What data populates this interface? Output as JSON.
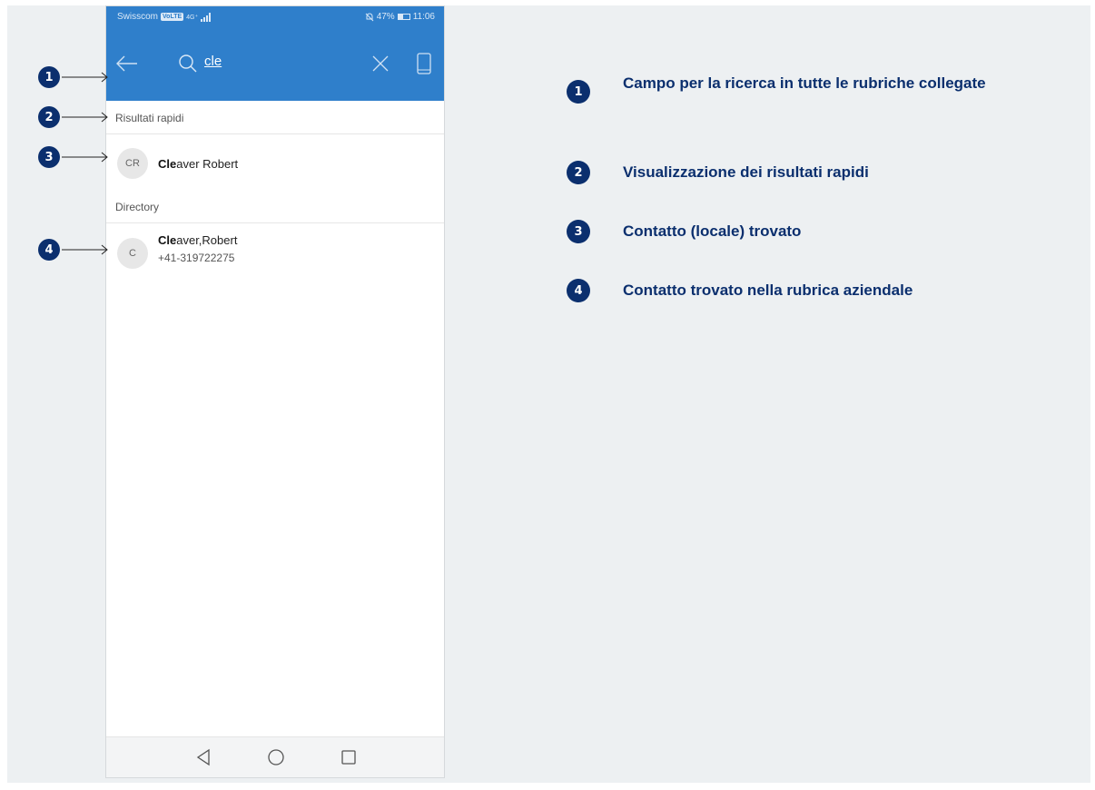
{
  "status_bar": {
    "carrier": "Swisscom",
    "network_badge": "VoLTE",
    "signal_label": "4G⁺",
    "battery": "47%",
    "time": "11:06"
  },
  "search": {
    "query": "cle"
  },
  "quick_results": {
    "header": "Risultati rapidi",
    "items": [
      {
        "initials": "CR",
        "match": "Cle",
        "rest": "aver Robert"
      }
    ]
  },
  "directory": {
    "header": "Directory",
    "items": [
      {
        "initials": "C",
        "match": "Cle",
        "rest": "aver,Robert",
        "phone": "+41-319722275"
      }
    ]
  },
  "callouts": [
    {
      "number": "1",
      "text": "Campo per la ricerca in tutte le rubriche collegate"
    },
    {
      "number": "2",
      "text": "Visualizzazione dei risultati rapidi"
    },
    {
      "number": "3",
      "text": "Contatto (locale) trovato"
    },
    {
      "number": "4",
      "text": "Contatto trovato nella rubrica aziendale"
    }
  ],
  "colors": {
    "app_bar": "#2f7fcb",
    "callout_badge": "#0b2f6e",
    "background_panel": "#edf0f2"
  }
}
